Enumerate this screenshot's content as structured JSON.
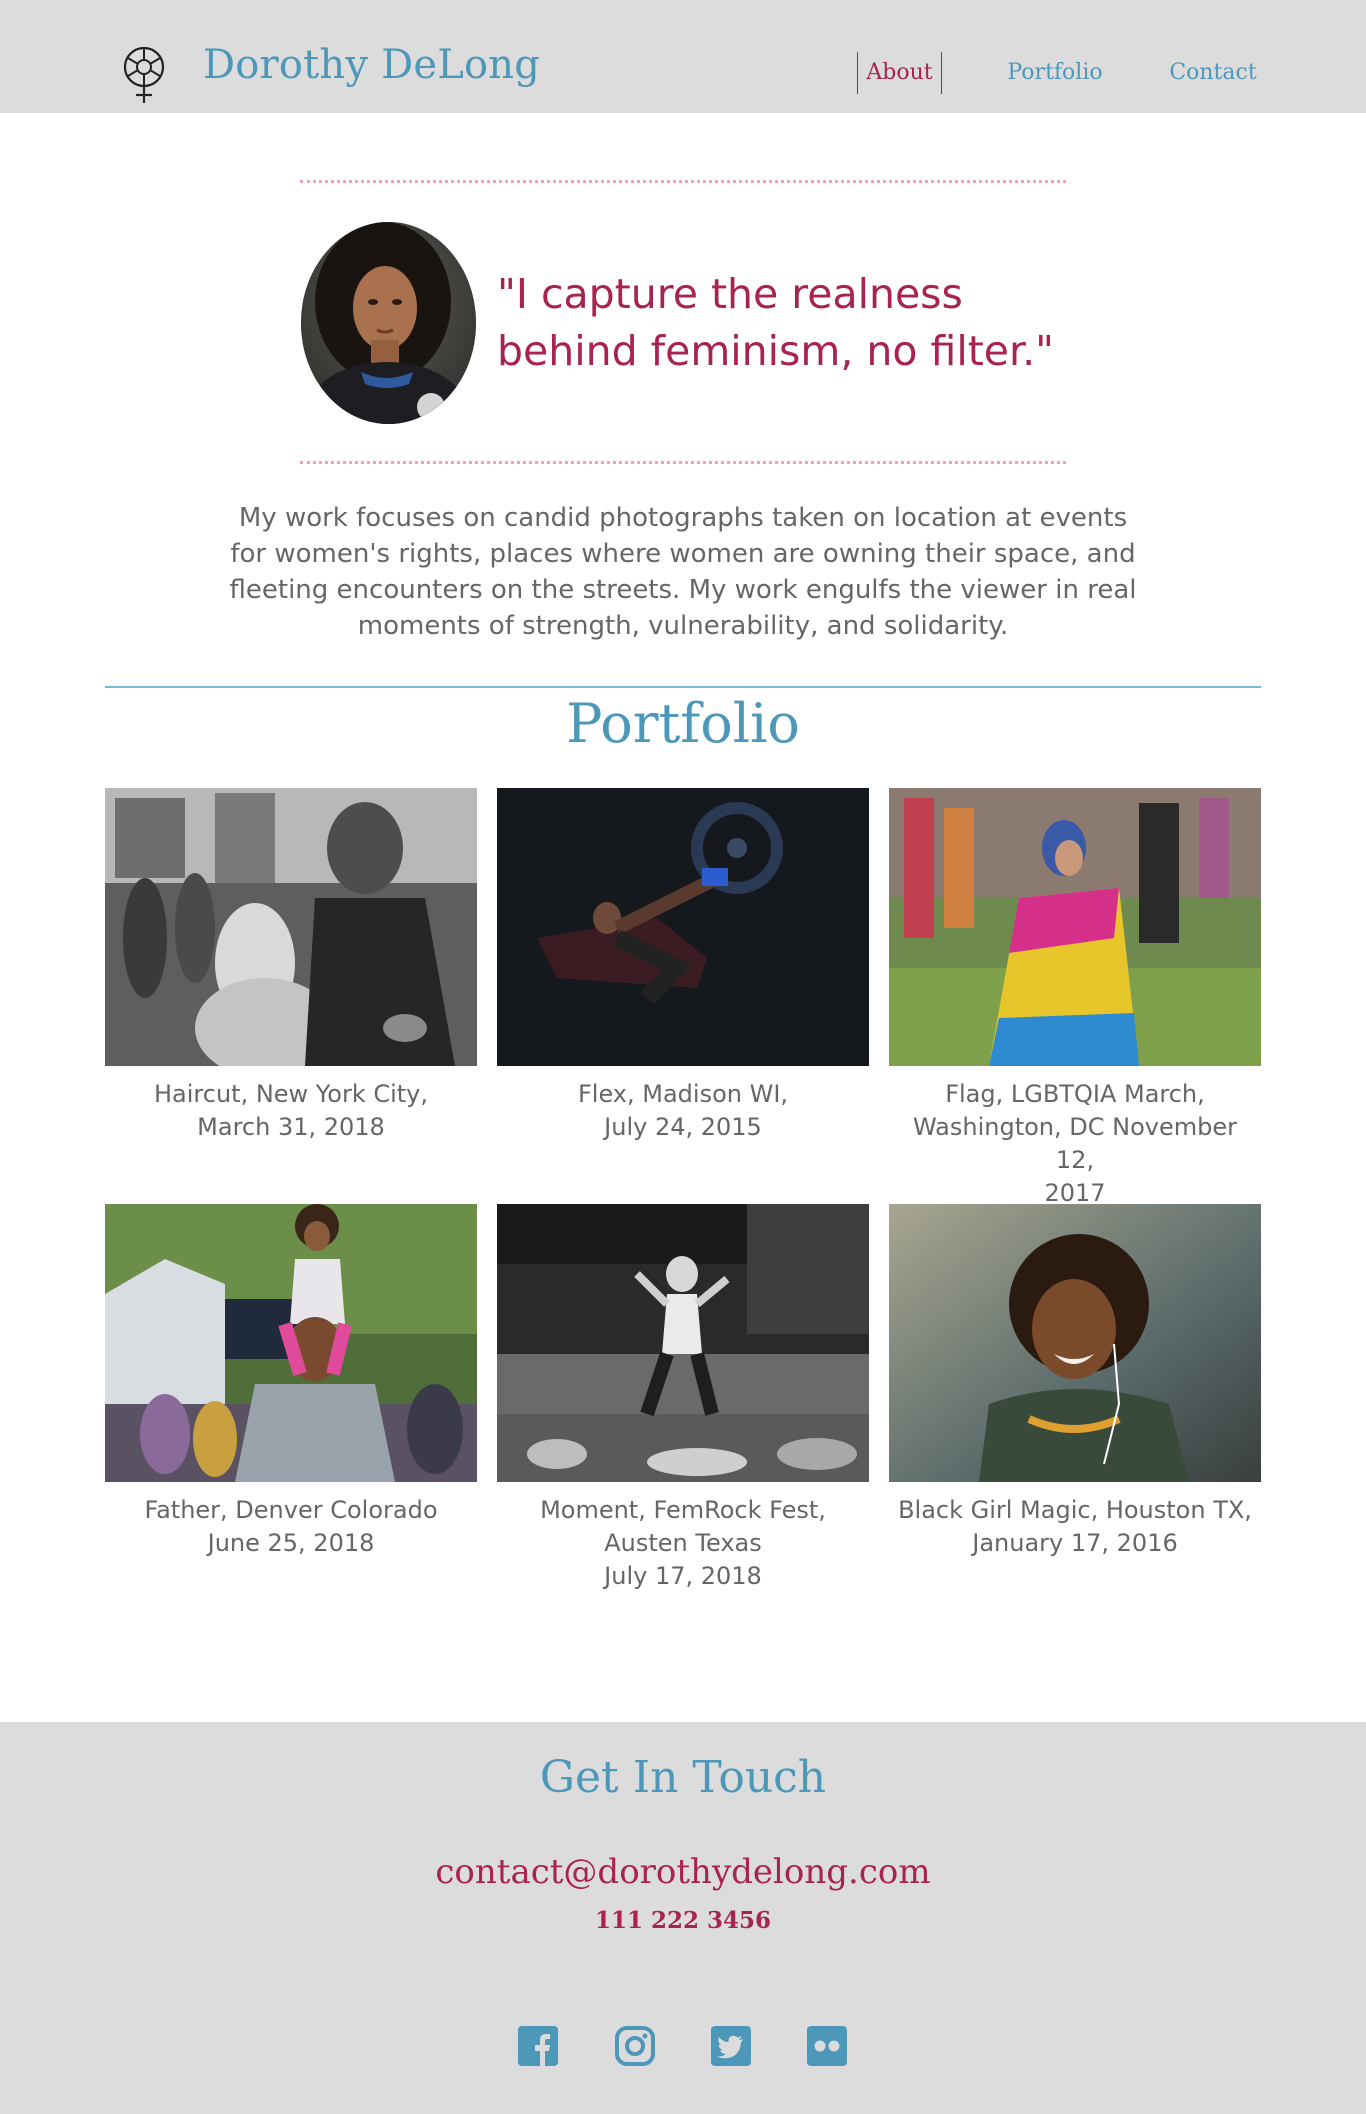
{
  "colors": {
    "brand_blue": "#4d97b9",
    "accent_crimson": "#a8234f",
    "header_bg": "#dcdcdc",
    "text_gray": "#666666",
    "dotted_pink": "#f4a1b4"
  },
  "header": {
    "logo_icon": "feminism-aperture-icon",
    "site_name": "Dorothy DeLong",
    "nav": [
      {
        "label": "About",
        "active": true
      },
      {
        "label": "Portfolio",
        "active": false
      },
      {
        "label": "Contact",
        "active": false
      }
    ]
  },
  "hero": {
    "avatar_icon": "portrait-photo",
    "quote": "\"I capture the realness behind feminism, no filter.\"",
    "intro": "My work focuses on candid photographs taken on location at events for women's rights, places where women are owning their space, and fleeting encounters on the streets. My work engulfs the viewer in real moments of strength, vulnerability, and solidarity."
  },
  "portfolio": {
    "title": "Portfolio",
    "items": [
      {
        "caption_lines": [
          "Haircut, New York City,",
          "March 31, 2018"
        ]
      },
      {
        "caption_lines": [
          "Flex, Madison WI,",
          "July 24, 2015"
        ]
      },
      {
        "caption_lines": [
          "Flag, LGBTQIA March,",
          "Washington, DC  November 12,",
          "2017"
        ]
      },
      {
        "caption_lines": [
          "Father, Denver Colorado",
          "June 25, 2018"
        ]
      },
      {
        "caption_lines": [
          "Moment, FemRock Fest,",
          "Austen Texas",
          "July 17, 2018"
        ]
      },
      {
        "caption_lines": [
          "Black Girl Magic, Houston TX,",
          "January 17, 2016"
        ]
      }
    ]
  },
  "contact": {
    "title": "Get In Touch",
    "email": "contact@dorothydelong.com",
    "phone": "111 222 3456",
    "social": [
      "facebook-icon",
      "instagram-icon",
      "twitter-icon",
      "flickr-icon"
    ]
  }
}
